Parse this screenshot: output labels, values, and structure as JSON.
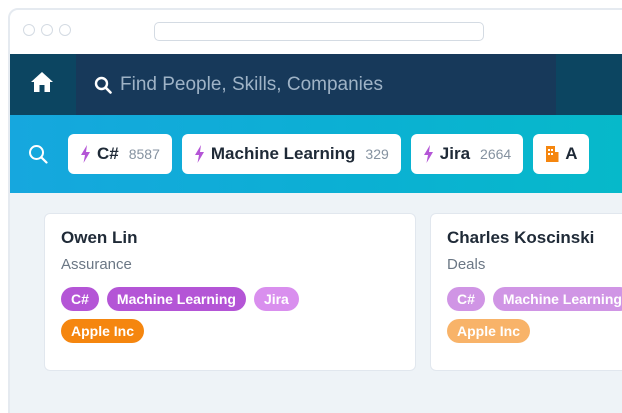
{
  "search": {
    "placeholder": "Find People, Skills, Companies"
  },
  "filters": [
    {
      "label": "C#",
      "count": "8587",
      "icon": "bolt-icon"
    },
    {
      "label": "Machine Learning",
      "count": "329",
      "icon": "bolt-icon"
    },
    {
      "label": "Jira",
      "count": "2664",
      "icon": "bolt-icon"
    },
    {
      "label": "A",
      "count": "",
      "icon": "building-icon"
    }
  ],
  "people": [
    {
      "name": "Owen Lin",
      "department": "Assurance",
      "skills": [
        "C#",
        "Machine Learning",
        "Jira"
      ],
      "company": "Apple Inc"
    },
    {
      "name": "Charles Koscinski",
      "department": "Deals",
      "skills": [
        "C#",
        "Machine Learning"
      ],
      "company": "Apple Inc"
    }
  ],
  "colors": {
    "nav_bg": "#0c4561",
    "search_bg": "#17395a",
    "filter_gradient_start": "#16a7de",
    "filter_gradient_end": "#06bac9",
    "skill_tag": "#b455d6",
    "skill_tag_light": "#d98fee",
    "company_tag": "#f5860f",
    "bolt": "#b455d6",
    "building": "#f5860f"
  }
}
